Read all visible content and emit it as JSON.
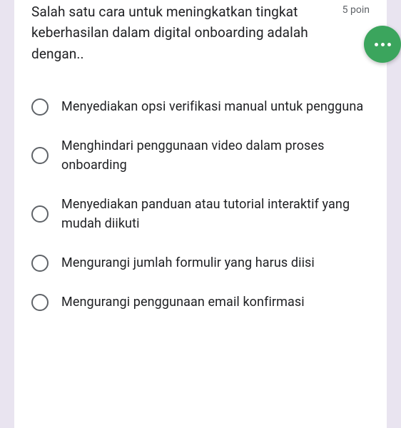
{
  "question": {
    "text": "Salah satu cara untuk meningkatkan tingkat keberhasilan dalam digital onboarding adalah dengan..",
    "points": "5 poin"
  },
  "options": [
    {
      "label": "Menyediakan opsi verifikasi manual untuk pengguna"
    },
    {
      "label": "Menghindari penggunaan video dalam proses onboarding"
    },
    {
      "label": "Menyediakan panduan atau tutorial interaktif yang mudah diikuti"
    },
    {
      "label": "Mengurangi jumlah formulir yang harus diisi"
    },
    {
      "label": "Mengurangi penggunaan email konfirmasi"
    }
  ]
}
